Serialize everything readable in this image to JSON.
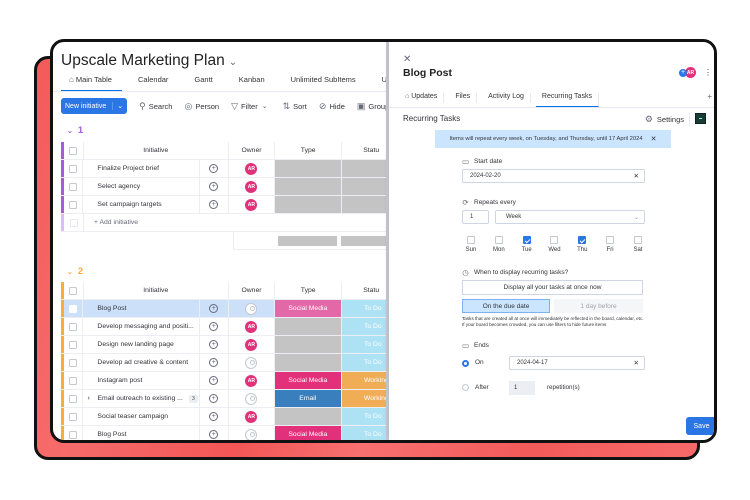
{
  "board": {
    "title": "Upscale Marketing Plan",
    "views": [
      {
        "label": "Main Table",
        "icon": "home-icon",
        "active": true
      },
      {
        "label": "Calendar"
      },
      {
        "label": "Gantt"
      },
      {
        "label": "Kanban"
      },
      {
        "label": "Unlimited SubItems"
      },
      {
        "label": "Unlimited Sub"
      }
    ],
    "toolbar": {
      "new_label": "New initiative",
      "search": "Search",
      "person": "Person",
      "filter": "Filter",
      "sort": "Sort",
      "hide": "Hide",
      "group_by": "Group b"
    },
    "columns": {
      "initiative": "Initiative",
      "owner": "Owner",
      "type": "Type",
      "status": "Statu"
    },
    "groups": [
      {
        "name": "1",
        "color": "#a25ddc",
        "add_label": "+ Add initiative",
        "rows": [
          {
            "name": "Finalize Project brief",
            "owner": "AR",
            "type": "",
            "status": ""
          },
          {
            "name": "Select agency",
            "owner": "AR",
            "type": "",
            "status": ""
          },
          {
            "name": "Set campaign targets",
            "owner": "AR",
            "type": "",
            "status": ""
          }
        ]
      },
      {
        "name": "2",
        "color": "#fdab3d",
        "rows": [
          {
            "name": "Blog Post",
            "owner": "",
            "type": "Social Media",
            "status": "To Do",
            "selected": true
          },
          {
            "name": "Develop messaging and positi...",
            "owner": "AR",
            "type": "",
            "status": "To Do"
          },
          {
            "name": "Design new landing page",
            "owner": "AR",
            "type": "",
            "status": "To Do"
          },
          {
            "name": "Develop ad creative & content",
            "owner": "",
            "type": "",
            "status": "To Do"
          },
          {
            "name": "Instagram post",
            "owner": "AR",
            "type": "Social Media",
            "status": "Working"
          },
          {
            "name": "Email outreach to existing ...",
            "owner": "",
            "type": "Email",
            "status": "Working",
            "subitems": "3"
          },
          {
            "name": "Social teaser campaign",
            "owner": "AR",
            "type": "",
            "status": "To Do"
          },
          {
            "name": "Blog Post",
            "owner": "",
            "type": "Social Media",
            "status": "To Do"
          }
        ]
      }
    ],
    "colors": {
      "social_media": "#e2317a",
      "social_media_selected": "#e368a8",
      "email": "#3a7fbd",
      "working": "#f0ad55",
      "todo": "#ade1f4",
      "empty": "#c4c4c4",
      "owner_avatar": "#e2317a"
    }
  },
  "panel": {
    "title": "Blog Post",
    "owner_initials": "AR",
    "tabs": [
      {
        "label": "Updates",
        "icon": "home-icon"
      },
      {
        "label": "Files"
      },
      {
        "label": "Activity Log"
      },
      {
        "label": "Recurring Tasks",
        "active": true
      }
    ],
    "section_title": "Recurring Tasks",
    "settings_label": "Settings",
    "banner": "Items will repeat every week, on Tuesday, and Thursday, until 17 April 2024",
    "start_date_label": "Start date",
    "start_date_value": "2024-02-20",
    "repeats_label": "Repeats every",
    "repeats_count": "1",
    "repeats_unit": "Week",
    "days": [
      {
        "label": "Sun",
        "checked": false
      },
      {
        "label": "Mon",
        "checked": false
      },
      {
        "label": "Tue",
        "checked": true
      },
      {
        "label": "Wed",
        "checked": false
      },
      {
        "label": "Thu",
        "checked": true
      },
      {
        "label": "Fri",
        "checked": false
      },
      {
        "label": "Sat",
        "checked": false
      }
    ],
    "display_label": "When to display recurring tasks?",
    "display_all": "Display all your tasks at once now",
    "on_due_date": "On the due date",
    "day_before": "1 day before",
    "hint": "Tasks that are created all at once will immediately be reflected in the board, calendar, etc. If your board becomes crowded, you can use filters to hide future items",
    "ends_label": "Ends",
    "on_label": "On",
    "end_date_value": "2024-04-17",
    "after_label": "After",
    "after_count": "1",
    "repetitions_label": "repetition(s)",
    "ends_mode": "on",
    "save_label": "Save"
  }
}
